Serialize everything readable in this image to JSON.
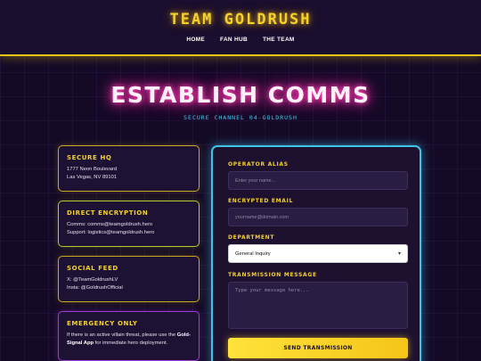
{
  "brand": "TEAM GOLDRUSH",
  "nav": [
    "HOME",
    "FAN HUB",
    "THE TEAM"
  ],
  "hero": {
    "title": "ESTABLISH COMMS",
    "subtitle": "SECURE CHANNEL 04-GOLDRUSH"
  },
  "cards": {
    "hq": {
      "title": "SECURE HQ",
      "line1": "1777 Neon Boulevard",
      "line2": "Las Vegas, NV 89101"
    },
    "encryption": {
      "title": "DIRECT ENCRYPTION",
      "line1": "Comms: comms@teamgoldrush.hero",
      "line2": "Support: logistics@teamgoldrush.hero"
    },
    "social": {
      "title": "SOCIAL FEED",
      "line1": "X: @TeamGoldrushLV",
      "line2": "Insta: @GoldrushOfficial"
    },
    "emergency": {
      "title": "EMERGENCY ONLY",
      "text_before": "If there is an active villain threat, please use the ",
      "app_name": "Gold-Signal App",
      "text_after": " for immediate hero deployment."
    }
  },
  "form": {
    "alias_label": "OPERATOR ALIAS",
    "alias_placeholder": "Enter your name...",
    "email_label": "ENCRYPTED EMAIL",
    "email_placeholder": "yourname@domain.com",
    "department_label": "DEPARTMENT",
    "department_value": "General Inquiry",
    "message_label": "TRANSMISSION MESSAGE",
    "message_placeholder": "Type your message here...",
    "submit_label": "SEND TRANSMISSION"
  },
  "colors": {
    "accent_gold": "#f5c518",
    "neon_pink": "#ff2fa8",
    "neon_cyan": "#3fc4e8",
    "background": "#140a26"
  }
}
